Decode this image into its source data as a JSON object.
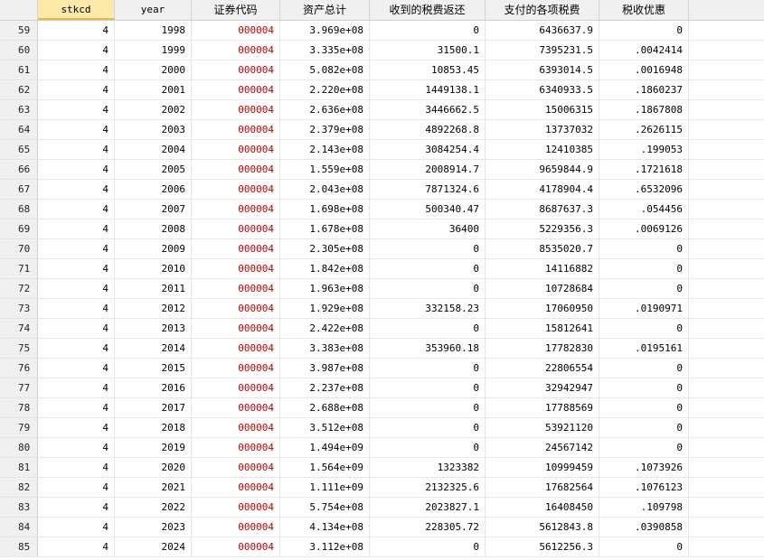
{
  "columns": [
    "stkcd",
    "year",
    "证券代码",
    "资产总计",
    "收到的税费返还",
    "支付的各项税费",
    "税收优惠"
  ],
  "selected_column": "stkcd",
  "rows": [
    {
      "n": "59",
      "stkcd": "4",
      "year": "1998",
      "code": "000004",
      "assets": "3.969e+08",
      "refund": "0",
      "taxpaid": "6436637.9",
      "benefit": "0"
    },
    {
      "n": "60",
      "stkcd": "4",
      "year": "1999",
      "code": "000004",
      "assets": "3.335e+08",
      "refund": "31500.1",
      "taxpaid": "7395231.5",
      "benefit": ".0042414"
    },
    {
      "n": "61",
      "stkcd": "4",
      "year": "2000",
      "code": "000004",
      "assets": "5.082e+08",
      "refund": "10853.45",
      "taxpaid": "6393014.5",
      "benefit": ".0016948"
    },
    {
      "n": "62",
      "stkcd": "4",
      "year": "2001",
      "code": "000004",
      "assets": "2.220e+08",
      "refund": "1449138.1",
      "taxpaid": "6340933.5",
      "benefit": ".1860237"
    },
    {
      "n": "63",
      "stkcd": "4",
      "year": "2002",
      "code": "000004",
      "assets": "2.636e+08",
      "refund": "3446662.5",
      "taxpaid": "15006315",
      "benefit": ".1867808"
    },
    {
      "n": "64",
      "stkcd": "4",
      "year": "2003",
      "code": "000004",
      "assets": "2.379e+08",
      "refund": "4892268.8",
      "taxpaid": "13737032",
      "benefit": ".2626115"
    },
    {
      "n": "65",
      "stkcd": "4",
      "year": "2004",
      "code": "000004",
      "assets": "2.143e+08",
      "refund": "3084254.4",
      "taxpaid": "12410385",
      "benefit": ".199053"
    },
    {
      "n": "66",
      "stkcd": "4",
      "year": "2005",
      "code": "000004",
      "assets": "1.559e+08",
      "refund": "2008914.7",
      "taxpaid": "9659844.9",
      "benefit": ".1721618"
    },
    {
      "n": "67",
      "stkcd": "4",
      "year": "2006",
      "code": "000004",
      "assets": "2.043e+08",
      "refund": "7871324.6",
      "taxpaid": "4178904.4",
      "benefit": ".6532096"
    },
    {
      "n": "68",
      "stkcd": "4",
      "year": "2007",
      "code": "000004",
      "assets": "1.698e+08",
      "refund": "500340.47",
      "taxpaid": "8687637.3",
      "benefit": ".054456"
    },
    {
      "n": "69",
      "stkcd": "4",
      "year": "2008",
      "code": "000004",
      "assets": "1.678e+08",
      "refund": "36400",
      "taxpaid": "5229356.3",
      "benefit": ".0069126"
    },
    {
      "n": "70",
      "stkcd": "4",
      "year": "2009",
      "code": "000004",
      "assets": "2.305e+08",
      "refund": "0",
      "taxpaid": "8535020.7",
      "benefit": "0"
    },
    {
      "n": "71",
      "stkcd": "4",
      "year": "2010",
      "code": "000004",
      "assets": "1.842e+08",
      "refund": "0",
      "taxpaid": "14116882",
      "benefit": "0"
    },
    {
      "n": "72",
      "stkcd": "4",
      "year": "2011",
      "code": "000004",
      "assets": "1.963e+08",
      "refund": "0",
      "taxpaid": "10728684",
      "benefit": "0"
    },
    {
      "n": "73",
      "stkcd": "4",
      "year": "2012",
      "code": "000004",
      "assets": "1.929e+08",
      "refund": "332158.23",
      "taxpaid": "17060950",
      "benefit": ".0190971"
    },
    {
      "n": "74",
      "stkcd": "4",
      "year": "2013",
      "code": "000004",
      "assets": "2.422e+08",
      "refund": "0",
      "taxpaid": "15812641",
      "benefit": "0"
    },
    {
      "n": "75",
      "stkcd": "4",
      "year": "2014",
      "code": "000004",
      "assets": "3.383e+08",
      "refund": "353960.18",
      "taxpaid": "17782830",
      "benefit": ".0195161"
    },
    {
      "n": "76",
      "stkcd": "4",
      "year": "2015",
      "code": "000004",
      "assets": "3.987e+08",
      "refund": "0",
      "taxpaid": "22806554",
      "benefit": "0"
    },
    {
      "n": "77",
      "stkcd": "4",
      "year": "2016",
      "code": "000004",
      "assets": "2.237e+08",
      "refund": "0",
      "taxpaid": "32942947",
      "benefit": "0"
    },
    {
      "n": "78",
      "stkcd": "4",
      "year": "2017",
      "code": "000004",
      "assets": "2.688e+08",
      "refund": "0",
      "taxpaid": "17788569",
      "benefit": "0"
    },
    {
      "n": "79",
      "stkcd": "4",
      "year": "2018",
      "code": "000004",
      "assets": "3.512e+08",
      "refund": "0",
      "taxpaid": "53921120",
      "benefit": "0"
    },
    {
      "n": "80",
      "stkcd": "4",
      "year": "2019",
      "code": "000004",
      "assets": "1.494e+09",
      "refund": "0",
      "taxpaid": "24567142",
      "benefit": "0"
    },
    {
      "n": "81",
      "stkcd": "4",
      "year": "2020",
      "code": "000004",
      "assets": "1.564e+09",
      "refund": "1323382",
      "taxpaid": "10999459",
      "benefit": ".1073926"
    },
    {
      "n": "82",
      "stkcd": "4",
      "year": "2021",
      "code": "000004",
      "assets": "1.111e+09",
      "refund": "2132325.6",
      "taxpaid": "17682564",
      "benefit": ".1076123"
    },
    {
      "n": "83",
      "stkcd": "4",
      "year": "2022",
      "code": "000004",
      "assets": "5.754e+08",
      "refund": "2023827.1",
      "taxpaid": "16408450",
      "benefit": ".109798"
    },
    {
      "n": "84",
      "stkcd": "4",
      "year": "2023",
      "code": "000004",
      "assets": "4.134e+08",
      "refund": "228305.72",
      "taxpaid": "5612843.8",
      "benefit": ".0390858"
    },
    {
      "n": "85",
      "stkcd": "4",
      "year": "2024",
      "code": "000004",
      "assets": "3.112e+08",
      "refund": "0",
      "taxpaid": "5612256.3",
      "benefit": "0"
    }
  ]
}
